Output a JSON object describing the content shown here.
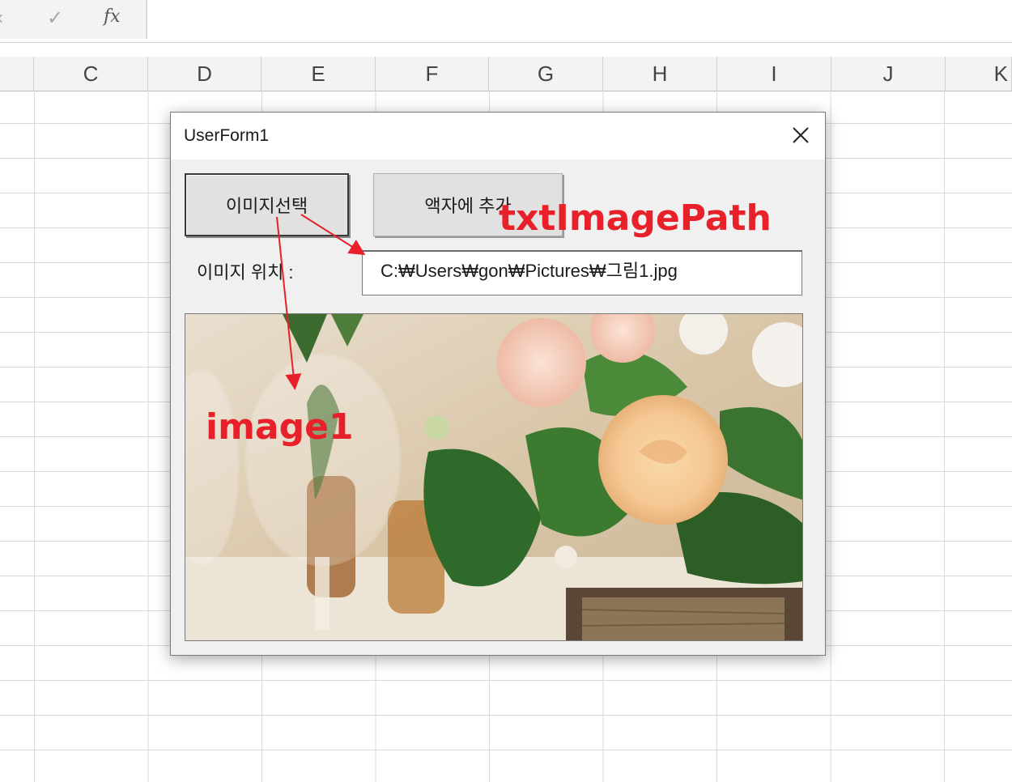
{
  "formula_bar": {
    "cancel_icon": "cancel-icon",
    "enter_icon": "check-icon",
    "fx_label": "fx",
    "value": ""
  },
  "columns": [
    "C",
    "D",
    "E",
    "F",
    "G",
    "H",
    "I",
    "J",
    "K"
  ],
  "dialog": {
    "title": "UserForm1",
    "close_icon": "close-icon",
    "select_button": "이미지선택",
    "add_button": "액자에 추가",
    "location_label": "이미지 위치 :",
    "path_value": "C:₩Users₩gon₩Pictures₩그림1.jpg",
    "image_name": "flower-photo"
  },
  "annotations": {
    "text_path": "txtImagePath",
    "image": "image1",
    "color": "#e8202a"
  }
}
